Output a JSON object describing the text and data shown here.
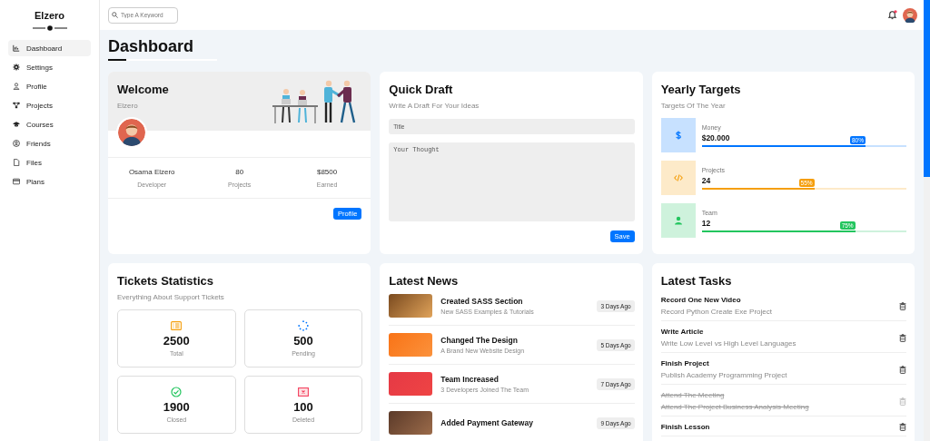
{
  "sidebar": {
    "brand": "Elzero",
    "items": [
      {
        "label": "Dashboard",
        "selected": true
      },
      {
        "label": "Settings",
        "selected": false
      },
      {
        "label": "Profile",
        "selected": false
      },
      {
        "label": "Projects",
        "selected": false
      },
      {
        "label": "Courses",
        "selected": false
      },
      {
        "label": "Friends",
        "selected": false
      },
      {
        "label": "Files",
        "selected": false
      },
      {
        "label": "Plans",
        "selected": false
      }
    ]
  },
  "topbar": {
    "search": {
      "placeholder": "Type A Keyword"
    }
  },
  "page_title": "Dashboard",
  "welcome": {
    "title": "Welcome",
    "subtitle": "Elzero",
    "stats": [
      {
        "value": "Osama Elzero",
        "label": "Developer"
      },
      {
        "value": "80",
        "label": "Projects"
      },
      {
        "value": "$8500",
        "label": "Earned"
      }
    ],
    "button": "Profile"
  },
  "quick_draft": {
    "title": "Quick Draft",
    "subtitle": "Write A Draft For Your Ideas",
    "title_field": {
      "placeholder": "Title"
    },
    "body_field": {
      "placeholder": "Your Thought"
    },
    "button": "Save"
  },
  "yearly_targets": {
    "title": "Yearly Targets",
    "subtitle": "Targets Of The Year",
    "targets": [
      {
        "kind": "money",
        "label": "Money",
        "value": "$20.000",
        "level": 0.8,
        "reading": "80%",
        "color": "#0075ff"
      },
      {
        "kind": "code",
        "label": "Projects",
        "value": "24",
        "level": 0.55,
        "reading": "55%",
        "color": "#f59e0b"
      },
      {
        "kind": "person",
        "label": "Team",
        "value": "12",
        "level": 0.75,
        "reading": "75%",
        "color": "#22c55e"
      }
    ]
  },
  "tickets": {
    "title": "Tickets Statistics",
    "subtitle": "Everything About Support Tickets",
    "stats": [
      {
        "kind": "list",
        "value": "2500",
        "label": "Total"
      },
      {
        "kind": "spinner",
        "value": "500",
        "label": "Pending"
      },
      {
        "kind": "check",
        "value": "1900",
        "label": "Closed"
      },
      {
        "kind": "cross",
        "value": "100",
        "label": "Deleted"
      }
    ]
  },
  "news": {
    "title": "Latest News",
    "items": [
      {
        "title": "Created SASS Section",
        "description": "New SASS Examples & Tutorials",
        "time": "3 Days Ago"
      },
      {
        "title": "Changed The Design",
        "description": "A Brand New Website Design",
        "time": "5 Days Ago"
      },
      {
        "title": "Team Increased",
        "description": "3 Developers Joined The Team",
        "time": "7 Days Ago"
      },
      {
        "title": "Added Payment Gateway",
        "time": "9 Days Ago"
      }
    ]
  },
  "tasks": {
    "title": "Latest Tasks",
    "items": [
      {
        "title": "Record One New Video",
        "description": "Record Python Create Exe Project",
        "done": false
      },
      {
        "title": "Write Article",
        "description": "Write Low Level vs High Level Languages",
        "done": false
      },
      {
        "title": "Finish Project",
        "description": "Publish Academy Programming Project",
        "done": false
      },
      {
        "title": "Attend The Meeting",
        "description": "Attend The Project Business Analysis Meeting",
        "done": true
      },
      {
        "title": "Finish Lesson",
        "done": false
      }
    ]
  }
}
